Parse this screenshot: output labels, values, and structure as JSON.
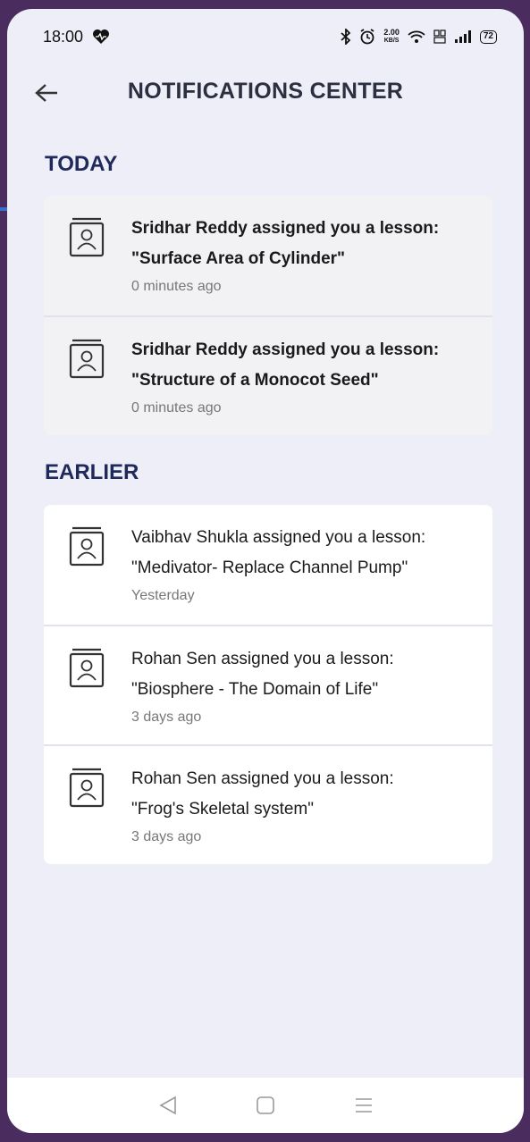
{
  "status_bar": {
    "time": "18:00",
    "speed_top": "2.00",
    "speed_bottom": "KB/S",
    "battery": "72"
  },
  "header": {
    "title": "NOTIFICATIONS CENTER",
    "back_icon": "back-arrow-icon"
  },
  "sections": {
    "today": {
      "heading": "TODAY",
      "items": [
        {
          "line1": "Sridhar Reddy assigned you a lesson:",
          "line2": "\"Surface Area of Cylinder\"",
          "time": "0 minutes ago",
          "icon": "lesson-book-icon"
        },
        {
          "line1": "Sridhar Reddy assigned you a lesson:",
          "line2": "\"Structure of a Monocot Seed\"",
          "time": "0 minutes ago",
          "icon": "lesson-book-icon"
        }
      ]
    },
    "earlier": {
      "heading": "EARLIER",
      "items": [
        {
          "line1": "Vaibhav Shukla assigned you a lesson:",
          "line2": "\"Medivator-  Replace Channel Pump\"",
          "time": "Yesterday",
          "icon": "lesson-book-icon"
        },
        {
          "line1": "Rohan Sen assigned you a lesson:",
          "line2": "\"Biosphere - The Domain of Life\"",
          "time": "3 days ago",
          "icon": "lesson-book-icon"
        },
        {
          "line1": "Rohan Sen assigned you a lesson:",
          "line2": "\"Frog's Skeletal system\"",
          "time": "3 days ago",
          "icon": "lesson-book-icon"
        }
      ]
    }
  },
  "colors": {
    "background": "#edeef8",
    "heading": "#1f2a5a",
    "today_card": "#f2f2f4",
    "earlier_card": "#ffffff",
    "arrow": "#3a6fd0"
  }
}
